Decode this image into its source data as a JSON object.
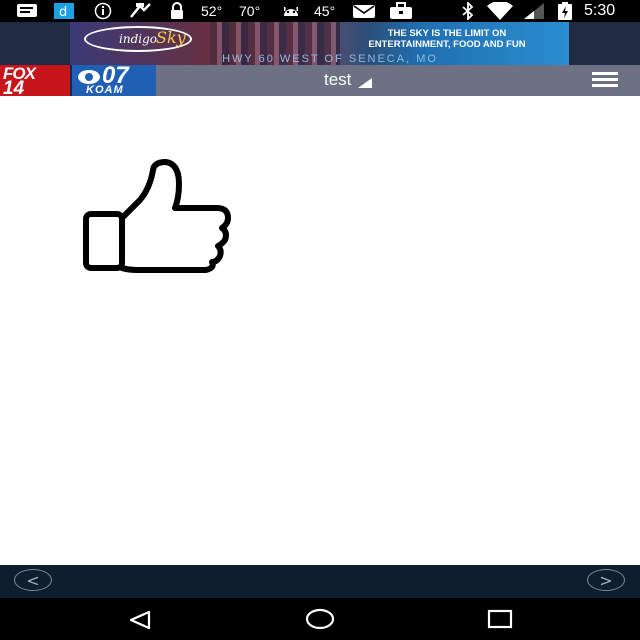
{
  "status_bar": {
    "temp1": "52°",
    "temp2": "70°",
    "temp3": "45°",
    "time": "5:30"
  },
  "ad": {
    "logo_text": "indigo",
    "logo_mark": "Sky",
    "line1": "THE SKY IS THE LIMIT ON",
    "line2": "ENTERTAINMENT, FOOD AND FUN",
    "line3": "HWY 60 WEST OF SENECA, MO"
  },
  "header": {
    "logo": {
      "fox_text": "FOX",
      "fox_number": "14",
      "cbs_number": "07",
      "koam_text": "KOAM"
    },
    "title": "test"
  },
  "main": {
    "icon": "thumbs-up-icon"
  },
  "nav": {
    "prev": "<",
    "next": ">"
  },
  "colors": {
    "status_bar": "#000000",
    "ad_strip": "#1e2b40",
    "header": "#6d7183",
    "nav_bar": "#0e1e2e",
    "system_nav": "#000000"
  }
}
